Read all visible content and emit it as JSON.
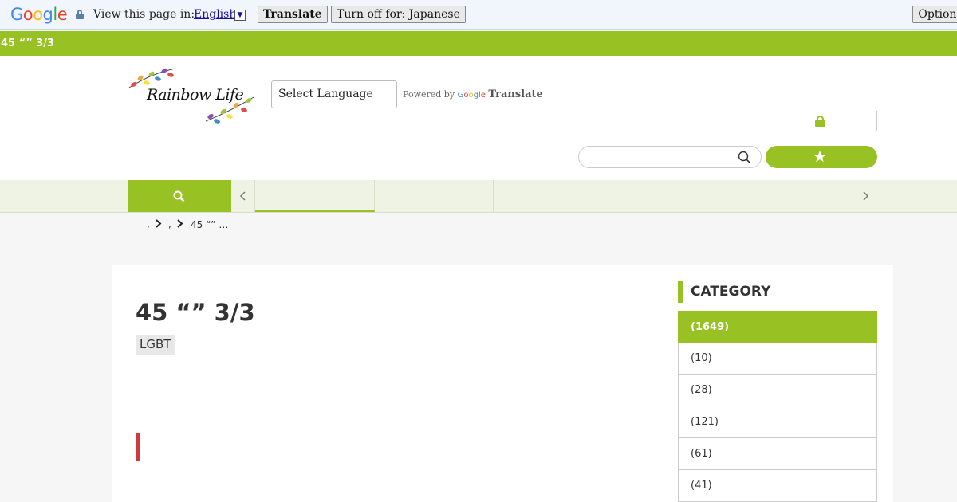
{
  "translate_bar": {
    "logo": "Google",
    "prompt": "View this page in:",
    "language": "English",
    "translate_button": "Translate",
    "turn_off_button": "Turn off for: Japanese",
    "options_button": "Options"
  },
  "page": {
    "title_strip": "45 “” 3/3"
  },
  "header": {
    "logo_text": "Rainbow Life",
    "language_select": "Select Language",
    "powered_by": "Powered by",
    "powered_google": "Google",
    "powered_translate": "Translate"
  },
  "breadcrumb": {
    "sep1": ",",
    "sep2": ",",
    "current": "45 “” …"
  },
  "article": {
    "title": "45 “” 3/3",
    "tag": "LGBT"
  },
  "sidebar": {
    "heading": "CATEGORY",
    "categories": [
      {
        "label": "(1649)"
      },
      {
        "label": "(10)"
      },
      {
        "label": "(28)"
      },
      {
        "label": "(121)"
      },
      {
        "label": "(61)"
      },
      {
        "label": "(41)"
      }
    ]
  },
  "colors": {
    "accent": "#98c124",
    "quote_bar": "#d0393e"
  },
  "icons": [
    "lock-icon",
    "search-icon",
    "star-icon",
    "chevron-left-icon",
    "chevron-right-icon"
  ]
}
